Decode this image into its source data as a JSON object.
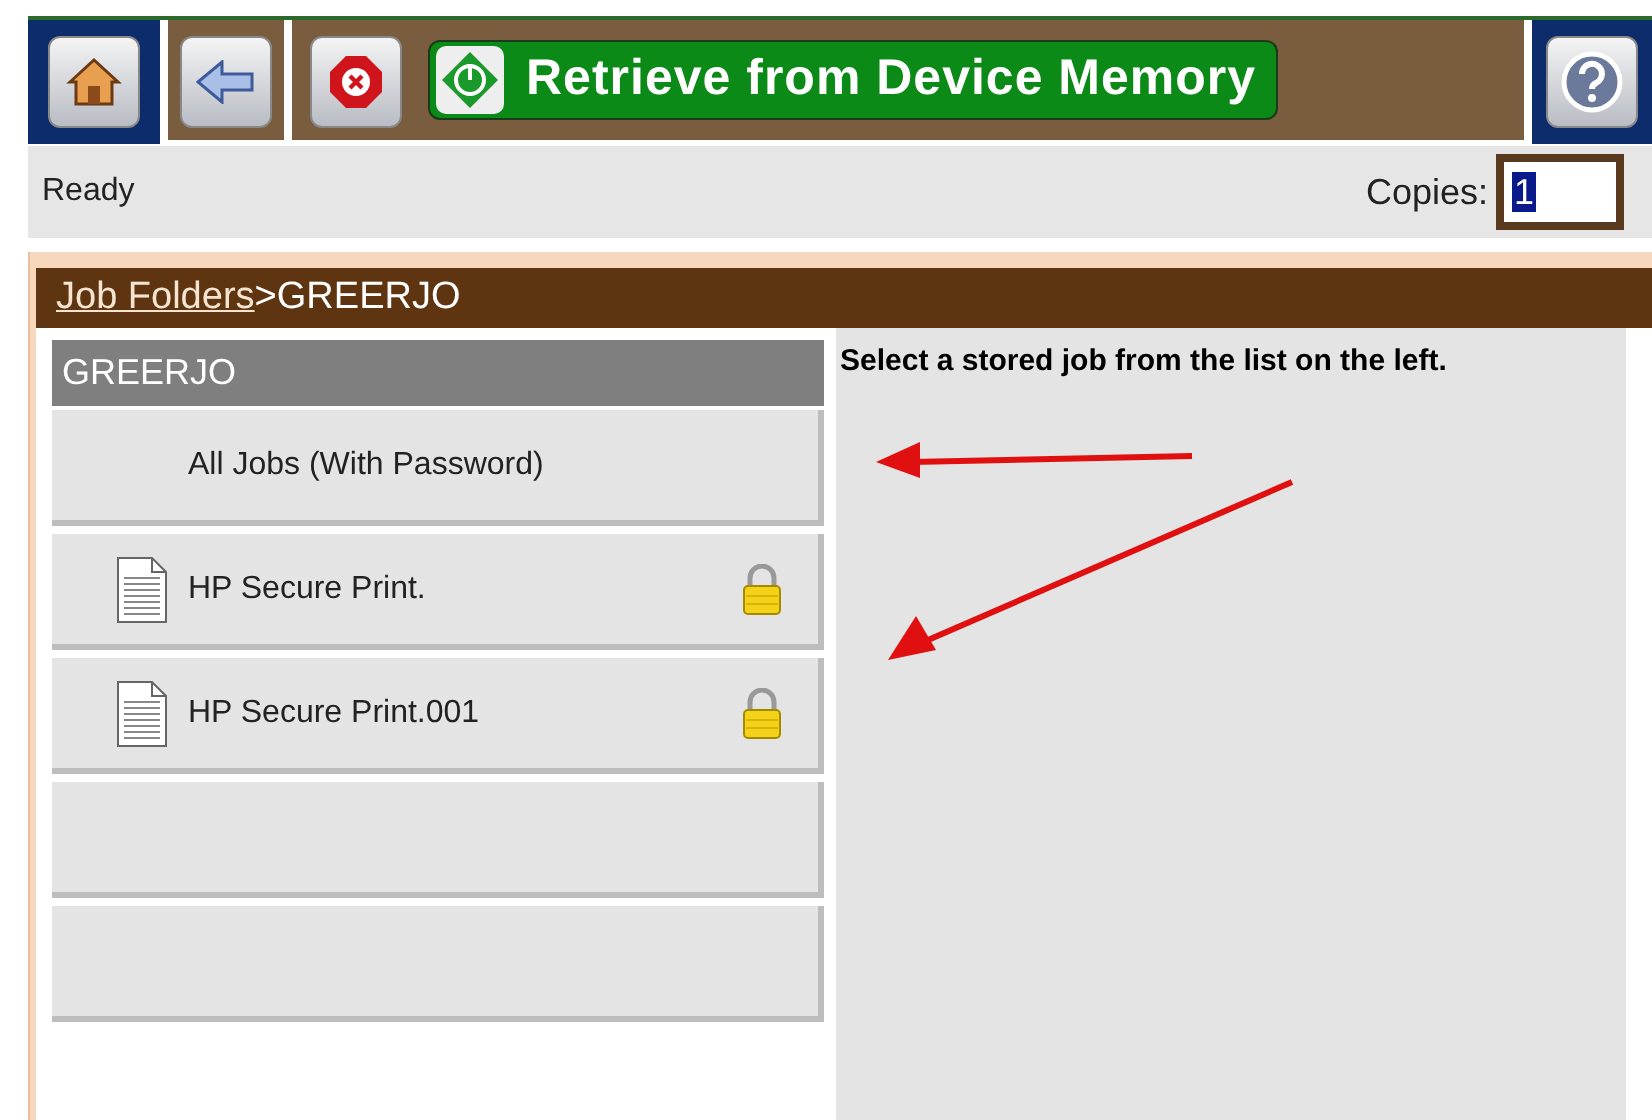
{
  "header": {
    "title": "Retrieve from Device Memory"
  },
  "status": {
    "text": "Ready",
    "copies_label": "Copies:",
    "copies_value": "1"
  },
  "breadcrumb": {
    "link": "Job Folders",
    "separator": ">",
    "current": "GREERJO"
  },
  "folder": {
    "title": "GREERJO",
    "items": [
      {
        "kind": "all",
        "label": "All Jobs (With Password)"
      },
      {
        "kind": "job",
        "label": "HP Secure Print.",
        "locked": true
      },
      {
        "kind": "job",
        "label": "HP Secure Print.001",
        "locked": true
      },
      {
        "kind": "empty"
      },
      {
        "kind": "empty"
      }
    ]
  },
  "instructions": "Select a stored job from the list on the left."
}
